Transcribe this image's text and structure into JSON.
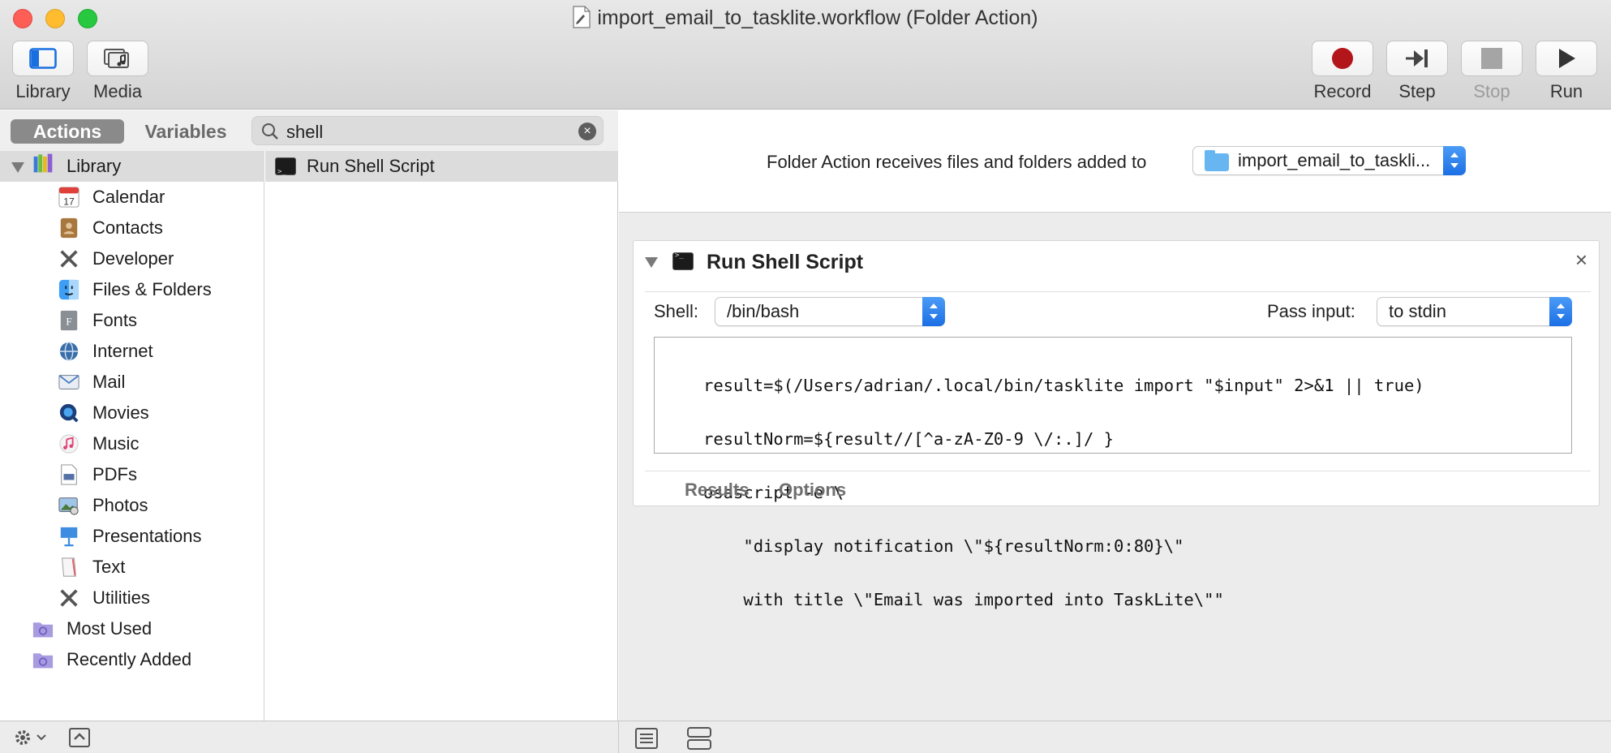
{
  "window": {
    "title": "import_email_to_tasklite.workflow (Folder Action)"
  },
  "toolbar": {
    "left": [
      {
        "label": "Library",
        "icon": "library-icon"
      },
      {
        "label": "Media",
        "icon": "media-icon"
      }
    ],
    "right": [
      {
        "label": "Record",
        "icon": "record-icon",
        "enabled": true
      },
      {
        "label": "Step",
        "icon": "step-icon",
        "enabled": true
      },
      {
        "label": "Stop",
        "icon": "stop-icon",
        "enabled": false
      },
      {
        "label": "Run",
        "icon": "run-icon",
        "enabled": true
      }
    ]
  },
  "tabs": {
    "actions": "Actions",
    "variables": "Variables",
    "selected": "Actions"
  },
  "search": {
    "value": "shell"
  },
  "library": {
    "root": "Library",
    "items": [
      {
        "label": "Calendar",
        "icon": "calendar-icon"
      },
      {
        "label": "Contacts",
        "icon": "contacts-icon"
      },
      {
        "label": "Developer",
        "icon": "developer-icon"
      },
      {
        "label": "Files & Folders",
        "icon": "finder-icon"
      },
      {
        "label": "Fonts",
        "icon": "fonts-icon"
      },
      {
        "label": "Internet",
        "icon": "internet-icon"
      },
      {
        "label": "Mail",
        "icon": "mail-icon"
      },
      {
        "label": "Movies",
        "icon": "movies-icon"
      },
      {
        "label": "Music",
        "icon": "music-icon"
      },
      {
        "label": "PDFs",
        "icon": "pdf-icon"
      },
      {
        "label": "Photos",
        "icon": "photos-icon"
      },
      {
        "label": "Presentations",
        "icon": "presentations-icon"
      },
      {
        "label": "Text",
        "icon": "text-icon"
      },
      {
        "label": "Utilities",
        "icon": "utilities-icon"
      }
    ],
    "smart": [
      {
        "label": "Most Used",
        "icon": "smart-folder-icon"
      },
      {
        "label": "Recently Added",
        "icon": "smart-folder-icon"
      }
    ]
  },
  "results": [
    {
      "label": "Run Shell Script",
      "icon": "terminal-icon"
    }
  ],
  "receives": {
    "text": "Folder Action receives files and folders added to",
    "folder": "import_email_to_taskli..."
  },
  "action": {
    "title": "Run Shell Script",
    "shell_label": "Shell:",
    "shell_value": "/bin/bash",
    "pass_label": "Pass input:",
    "pass_value": "to stdin",
    "code": [
      "result=$(/Users/adrian/.local/bin/tasklite import \"$input\" 2>&1 || true)",
      "resultNorm=${result//[^a-zA-Z0-9 \\/:.]/ }",
      "osascript -e \\",
      "    \"display notification \\\"${resultNorm:0:80}\\\"",
      "    with title \\\"Email was imported into TaskLite\\\"\""
    ],
    "tabs": [
      "Results",
      "Options"
    ]
  }
}
